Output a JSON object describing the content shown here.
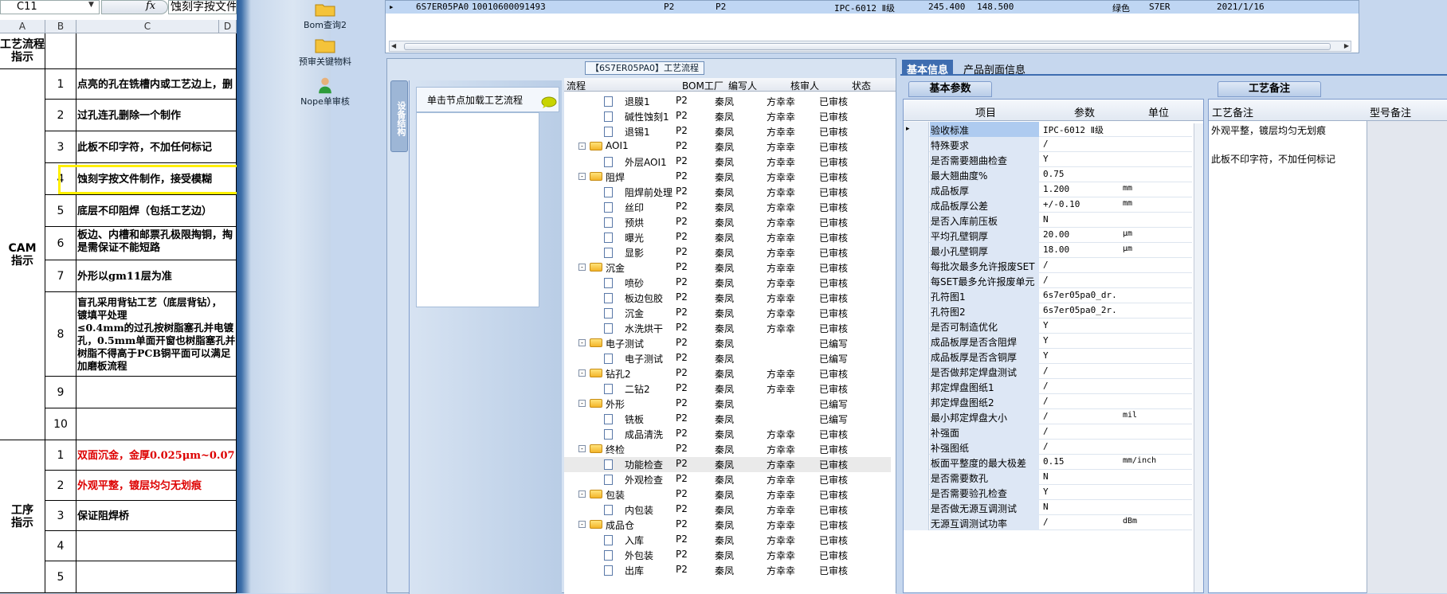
{
  "excel": {
    "namebox": "C11",
    "fx": "fx",
    "formula": "蚀刻字按文件",
    "columns": [
      "A",
      "B",
      "C",
      "D"
    ],
    "rows": [
      {
        "a": "工艺流程\n指示",
        "b": "",
        "c": ""
      },
      {
        "a": "CAM\n指示",
        "b": "1",
        "c": "点亮的孔在铣槽内或工艺边上，删"
      },
      {
        "a": "",
        "b": "2",
        "c": "过孔连孔删除一个制作"
      },
      {
        "a": "",
        "b": "3",
        "c": "此板不印字符，不加任何标记"
      },
      {
        "a": "",
        "b": "4",
        "c": "蚀刻字按文件制作，接受模糊"
      },
      {
        "a": "",
        "b": "5",
        "c": "底层不印阻焊（包括工艺边）"
      },
      {
        "a": "",
        "b": "6",
        "c": "板边、内槽和邮票孔极限掏铜，掏\n是需保证不能短路"
      },
      {
        "a": "",
        "b": "7",
        "c": "外形以gm11层为准"
      },
      {
        "a": "",
        "b": "8",
        "c": "盲孔采用背钻工艺（底层背钻），\n镀填平处理\n≤0.4mm的过孔按树脂塞孔并电镀\n孔，0.5mm单面开窗也树脂塞孔并\n树脂不得高于PCB铜平面可以满足\n加磨板流程"
      },
      {
        "a": "",
        "b": "9",
        "c": ""
      },
      {
        "a": "",
        "b": "10",
        "c": ""
      },
      {
        "a": "工序\n指示",
        "b": "1",
        "c": "双面沉金，金厚0.025μm~0.07"
      },
      {
        "a": "",
        "b": "2",
        "c": "外观平整，镀层均匀无划痕"
      },
      {
        "a": "",
        "b": "3",
        "c": "保证阻焊桥"
      },
      {
        "a": "",
        "b": "4",
        "c": ""
      },
      {
        "a": "",
        "b": "5",
        "c": ""
      }
    ]
  },
  "sidebar": {
    "items": [
      {
        "label": "Bom查询2",
        "icon": "folder-icon"
      },
      {
        "label": "预审关键物料",
        "icon": "folder-icon"
      },
      {
        "label": "Nope单审核",
        "icon": "user-icon"
      }
    ]
  },
  "top_grid": {
    "row": [
      "6S7ER05PA0",
      "10010600091493",
      "P2",
      "P2",
      "IPC-6012 Ⅱ级",
      "245.400",
      "148.500",
      "绿色",
      "S7ER",
      "2021/1/16"
    ]
  },
  "flow": {
    "title": "【6S7ER05PA0】工艺流程",
    "vtab": "设备结构",
    "node_header": "单击节点加载工艺流程",
    "columns": [
      "流程",
      "BOM工厂",
      "编写人",
      "核审人",
      "状态"
    ],
    "rows": [
      {
        "indent": 2,
        "kind": "doc",
        "name": "退膜1",
        "bom": "P2",
        "writer": "秦凤",
        "reviewer": "方幸幸",
        "status": "已审核"
      },
      {
        "indent": 2,
        "kind": "doc",
        "name": "碱性蚀刻1",
        "bom": "P2",
        "writer": "秦凤",
        "reviewer": "方幸幸",
        "status": "已审核"
      },
      {
        "indent": 2,
        "kind": "doc",
        "name": "退锡1",
        "bom": "P2",
        "writer": "秦凤",
        "reviewer": "方幸幸",
        "status": "已审核"
      },
      {
        "indent": 1,
        "kind": "folder",
        "name": "AOI1",
        "bom": "P2",
        "writer": "秦凤",
        "reviewer": "方幸幸",
        "status": "已审核"
      },
      {
        "indent": 2,
        "kind": "doc",
        "name": "外层AOI1",
        "bom": "P2",
        "writer": "秦凤",
        "reviewer": "方幸幸",
        "status": "已审核"
      },
      {
        "indent": 1,
        "kind": "folder",
        "name": "阻焊",
        "bom": "P2",
        "writer": "秦凤",
        "reviewer": "方幸幸",
        "status": "已审核"
      },
      {
        "indent": 2,
        "kind": "doc",
        "name": "阻焊前处理",
        "bom": "P2",
        "writer": "秦凤",
        "reviewer": "方幸幸",
        "status": "已审核"
      },
      {
        "indent": 2,
        "kind": "doc",
        "name": "丝印",
        "bom": "P2",
        "writer": "秦凤",
        "reviewer": "方幸幸",
        "status": "已审核"
      },
      {
        "indent": 2,
        "kind": "doc",
        "name": "预烘",
        "bom": "P2",
        "writer": "秦凤",
        "reviewer": "方幸幸",
        "status": "已审核"
      },
      {
        "indent": 2,
        "kind": "doc",
        "name": "曝光",
        "bom": "P2",
        "writer": "秦凤",
        "reviewer": "方幸幸",
        "status": "已审核"
      },
      {
        "indent": 2,
        "kind": "doc",
        "name": "显影",
        "bom": "P2",
        "writer": "秦凤",
        "reviewer": "方幸幸",
        "status": "已审核"
      },
      {
        "indent": 1,
        "kind": "folder",
        "name": "沉金",
        "bom": "P2",
        "writer": "秦凤",
        "reviewer": "方幸幸",
        "status": "已审核"
      },
      {
        "indent": 2,
        "kind": "doc",
        "name": "喷砂",
        "bom": "P2",
        "writer": "秦凤",
        "reviewer": "方幸幸",
        "status": "已审核"
      },
      {
        "indent": 2,
        "kind": "doc",
        "name": "板边包胶",
        "bom": "P2",
        "writer": "秦凤",
        "reviewer": "方幸幸",
        "status": "已审核"
      },
      {
        "indent": 2,
        "kind": "doc",
        "name": "沉金",
        "bom": "P2",
        "writer": "秦凤",
        "reviewer": "方幸幸",
        "status": "已审核"
      },
      {
        "indent": 2,
        "kind": "doc",
        "name": "水洗烘干",
        "bom": "P2",
        "writer": "秦凤",
        "reviewer": "方幸幸",
        "status": "已审核"
      },
      {
        "indent": 1,
        "kind": "folder",
        "name": "电子测试",
        "bom": "P2",
        "writer": "秦凤",
        "reviewer": "",
        "status": "已编写"
      },
      {
        "indent": 2,
        "kind": "doc",
        "name": "电子测试",
        "bom": "P2",
        "writer": "秦凤",
        "reviewer": "",
        "status": "已编写"
      },
      {
        "indent": 1,
        "kind": "folder",
        "name": "钻孔2",
        "bom": "P2",
        "writer": "秦凤",
        "reviewer": "方幸幸",
        "status": "已审核"
      },
      {
        "indent": 2,
        "kind": "doc",
        "name": "二钻2",
        "bom": "P2",
        "writer": "秦凤",
        "reviewer": "方幸幸",
        "status": "已审核"
      },
      {
        "indent": 1,
        "kind": "folder",
        "name": "外形",
        "bom": "P2",
        "writer": "秦凤",
        "reviewer": "",
        "status": "已编写"
      },
      {
        "indent": 2,
        "kind": "doc",
        "name": "铣板",
        "bom": "P2",
        "writer": "秦凤",
        "reviewer": "",
        "status": "已编写"
      },
      {
        "indent": 2,
        "kind": "doc",
        "name": "成品清洗",
        "bom": "P2",
        "writer": "秦凤",
        "reviewer": "方幸幸",
        "status": "已审核"
      },
      {
        "indent": 1,
        "kind": "folder",
        "name": "终检",
        "bom": "P2",
        "writer": "秦凤",
        "reviewer": "方幸幸",
        "status": "已审核"
      },
      {
        "indent": 2,
        "kind": "doc",
        "name": "功能检查",
        "bom": "P2",
        "writer": "秦凤",
        "reviewer": "方幸幸",
        "status": "已审核",
        "sel": true
      },
      {
        "indent": 2,
        "kind": "doc",
        "name": "外观检查",
        "bom": "P2",
        "writer": "秦凤",
        "reviewer": "方幸幸",
        "status": "已审核"
      },
      {
        "indent": 1,
        "kind": "folder",
        "name": "包装",
        "bom": "P2",
        "writer": "秦凤",
        "reviewer": "方幸幸",
        "status": "已审核"
      },
      {
        "indent": 2,
        "kind": "doc",
        "name": "内包装",
        "bom": "P2",
        "writer": "秦凤",
        "reviewer": "方幸幸",
        "status": "已审核"
      },
      {
        "indent": 1,
        "kind": "folder",
        "name": "成品仓",
        "bom": "P2",
        "writer": "秦凤",
        "reviewer": "方幸幸",
        "status": "已审核"
      },
      {
        "indent": 2,
        "kind": "doc",
        "name": "入库",
        "bom": "P2",
        "writer": "秦凤",
        "reviewer": "方幸幸",
        "status": "已审核"
      },
      {
        "indent": 2,
        "kind": "doc",
        "name": "外包装",
        "bom": "P2",
        "writer": "秦凤",
        "reviewer": "方幸幸",
        "status": "已审核"
      },
      {
        "indent": 2,
        "kind": "doc",
        "name": "出库",
        "bom": "P2",
        "writer": "秦凤",
        "reviewer": "方幸幸",
        "status": "已审核"
      }
    ]
  },
  "right": {
    "tabs": [
      "基本信息",
      "产品剖面信息"
    ],
    "basic_tab": "基本参数",
    "remark_tab": "工艺备注",
    "basic_columns": [
      "项目",
      "参数",
      "单位"
    ],
    "basic_rows": [
      {
        "k": "验收标准",
        "v": "IPC-6012 Ⅱ级",
        "u": "",
        "sel": true
      },
      {
        "k": "特殊要求",
        "v": "/",
        "u": ""
      },
      {
        "k": "是否需要翘曲检查",
        "v": "Y",
        "u": ""
      },
      {
        "k": "最大翘曲度%",
        "v": "0.75",
        "u": ""
      },
      {
        "k": "成品板厚",
        "v": "1.200",
        "u": "mm"
      },
      {
        "k": "成品板厚公差",
        "v": "+/-0.10",
        "u": "mm"
      },
      {
        "k": "是否入库前压板",
        "v": "N",
        "u": ""
      },
      {
        "k": "平均孔壁铜厚",
        "v": "20.00",
        "u": "μm"
      },
      {
        "k": "最小孔壁铜厚",
        "v": "18.00",
        "u": "μm"
      },
      {
        "k": "每批次最多允许报废SET",
        "v": "/",
        "u": ""
      },
      {
        "k": "每SET最多允许报废单元",
        "v": "/",
        "u": ""
      },
      {
        "k": "孔符图1",
        "v": "6s7er05pa0_dr...",
        "u": ""
      },
      {
        "k": "孔符图2",
        "v": "6s7er05pa0_2r...",
        "u": ""
      },
      {
        "k": "是否可制造优化",
        "v": "Y",
        "u": ""
      },
      {
        "k": "成品板厚是否含阻焊",
        "v": "Y",
        "u": ""
      },
      {
        "k": "成品板厚是否含铜厚",
        "v": "Y",
        "u": ""
      },
      {
        "k": "是否做邦定焊盘测试",
        "v": "/",
        "u": ""
      },
      {
        "k": "邦定焊盘图纸1",
        "v": "/",
        "u": ""
      },
      {
        "k": "邦定焊盘图纸2",
        "v": "/",
        "u": ""
      },
      {
        "k": "最小邦定焊盘大小",
        "v": "/",
        "u": "mil"
      },
      {
        "k": "补强面",
        "v": "/",
        "u": ""
      },
      {
        "k": "补强图纸",
        "v": "/",
        "u": ""
      },
      {
        "k": "板面平整度的最大极差",
        "v": "0.15",
        "u": "mm/inch"
      },
      {
        "k": "是否需要数孔",
        "v": "N",
        "u": ""
      },
      {
        "k": "是否需要验孔检查",
        "v": "Y",
        "u": ""
      },
      {
        "k": "是否做无源互调测试",
        "v": "N",
        "u": ""
      },
      {
        "k": "无源互调测试功率",
        "v": "/",
        "u": "dBm"
      }
    ],
    "remark_columns": [
      "工艺备注",
      "型号备注"
    ],
    "remark_text": "外观平整，镀层均匀无划痕\n\n此板不印字符，不加任何标记"
  }
}
